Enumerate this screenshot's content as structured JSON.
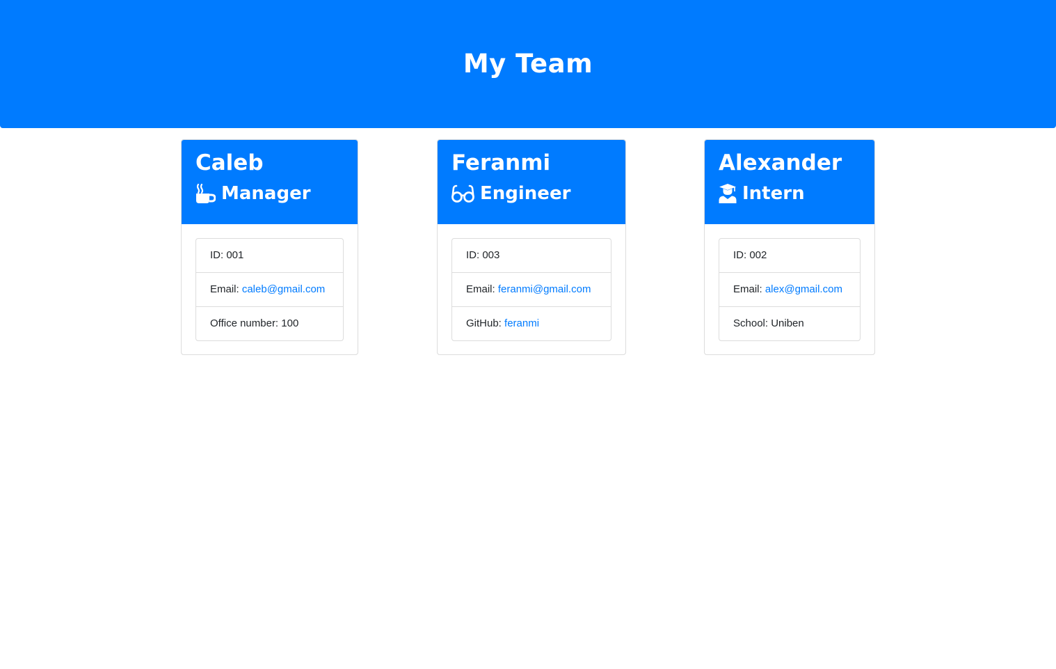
{
  "page": {
    "title": "My Team"
  },
  "colors": {
    "primary": "#007bff",
    "link": "#007bff",
    "text": "#212529",
    "border": "#dcdcdc"
  },
  "employees": [
    {
      "name": "Caleb",
      "role": "Manager",
      "icon": "mug-icon",
      "details": [
        {
          "label": "ID: ",
          "value": "001"
        },
        {
          "label": "Email: ",
          "value": "caleb@gmail.com",
          "link": true
        },
        {
          "label": "Office number: ",
          "value": "100"
        }
      ]
    },
    {
      "name": "Feranmi",
      "role": "Engineer",
      "icon": "glasses-icon",
      "details": [
        {
          "label": "ID: ",
          "value": "003"
        },
        {
          "label": "Email: ",
          "value": "feranmi@gmail.com",
          "link": true
        },
        {
          "label": "GitHub: ",
          "value": "feranmi",
          "link": true
        }
      ]
    },
    {
      "name": "Alexander",
      "role": "Intern",
      "icon": "graduate-icon",
      "details": [
        {
          "label": "ID: ",
          "value": "002"
        },
        {
          "label": "Email: ",
          "value": "alex@gmail.com",
          "link": true
        },
        {
          "label": "School: ",
          "value": "Uniben"
        }
      ]
    }
  ]
}
